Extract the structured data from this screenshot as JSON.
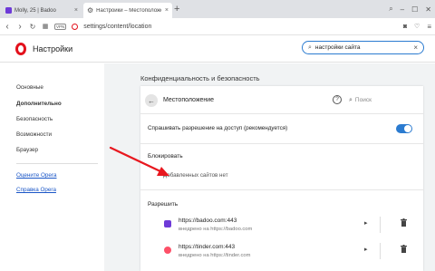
{
  "tabs": [
    {
      "title": "Molly, 25 | Badoo",
      "close": "×"
    },
    {
      "title": "Настройки – Местоположени",
      "close": "×"
    }
  ],
  "new_tab": "+",
  "address": {
    "url": "settings/content/location",
    "vpn": "VPN"
  },
  "settings": {
    "title": "Настройки",
    "search_value": "настройки сайта",
    "search_clear": "×"
  },
  "sidebar": {
    "items": [
      {
        "label": "Основные"
      },
      {
        "label": "Дополнительно"
      },
      {
        "label": "Безопасность"
      },
      {
        "label": "Возможности"
      },
      {
        "label": "Браузер"
      }
    ],
    "links": [
      {
        "label": "Оцените Opera"
      },
      {
        "label": "Справка Opera"
      }
    ]
  },
  "section_title": "Конфиденциальность и безопасность",
  "location": {
    "title": "Местоположение",
    "search_placeholder": "Поиск",
    "help": "?",
    "ask_label": "Спрашивать разрешение на доступ (рекомендуется)",
    "ask_enabled": true,
    "block_heading": "Блокировать",
    "block_empty": "Добавленных сайтов нет",
    "allow_heading": "Разрешить",
    "allowed_sites": [
      {
        "url": "https://badoo.com:443",
        "embedded": "внедрено на https://badoo.com",
        "icon": "badoo-icon",
        "color": "#6e3ad8"
      },
      {
        "url": "https://tinder.com:443",
        "embedded": "внедрено на https://tinder.com",
        "icon": "tinder-icon",
        "color": "#fd5068"
      }
    ]
  },
  "colors": {
    "opera_red": "#e3111c",
    "toggle_blue": "#2b7bd0",
    "link_blue": "#1a56c7",
    "arrow_red": "#e8181f"
  }
}
